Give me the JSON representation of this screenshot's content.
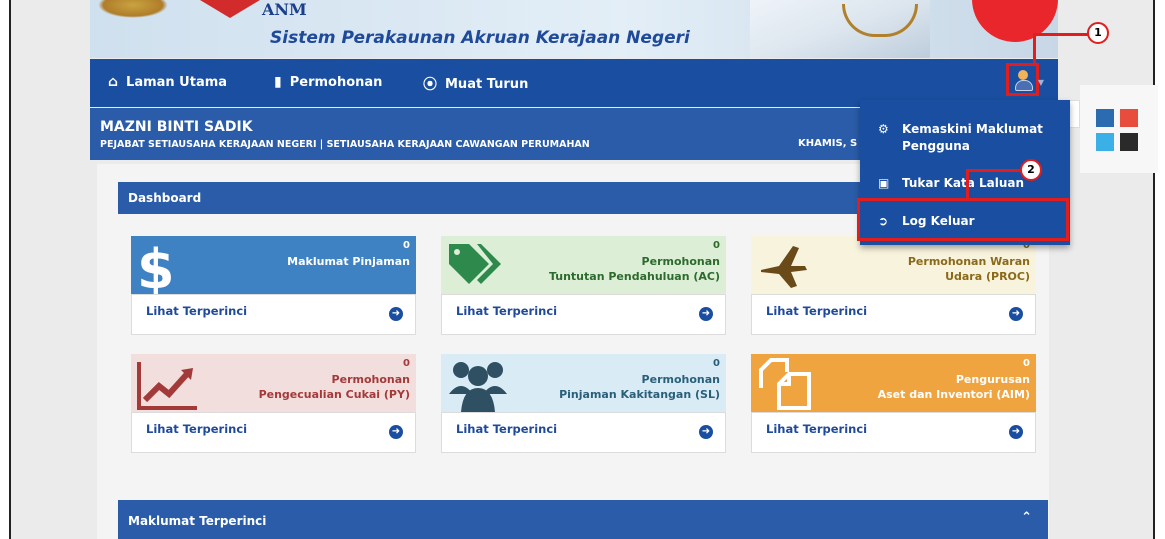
{
  "banner": {
    "org_short": "ANM",
    "system_title": "Sistem Perakaunan Akruan Kerajaan Negeri"
  },
  "nav": {
    "items": [
      {
        "label": "Laman Utama",
        "icon": "home-icon"
      },
      {
        "label": "Permohonan",
        "icon": "book-icon"
      },
      {
        "label": "Muat Turun",
        "icon": "download-icon"
      }
    ]
  },
  "user": {
    "name": "MAZNI BINTI SADIK",
    "department": "PEJABAT SETIAUSAHA KERAJAAN NEGERI | SETIAUSAHA KERAJAAN CAWANGAN PERUMAHAN",
    "date_partial": "KHAMIS, S"
  },
  "dashboard": {
    "title": "Dashboard",
    "cards": [
      {
        "count": "0",
        "title": "Maklumat Pinjaman",
        "link": "Lihat Terperinci",
        "icon": "dollar-icon",
        "color": "#3f82c4"
      },
      {
        "count": "0",
        "title_line1": "Permohonan",
        "title_line2": "Tuntutan Pendahuluan (AC)",
        "link": "Lihat Terperinci",
        "icon": "tags-icon",
        "color": "#dcefd6"
      },
      {
        "count": "0",
        "title_line1": "Permohonan Waran",
        "title_line2": "Udara (PROC)",
        "link": "Lihat Terperinci",
        "icon": "plane-icon",
        "color": "#f7f3dc"
      },
      {
        "count": "0",
        "title_line1": "Permohonan",
        "title_line2": "Pengecualian Cukai (PY)",
        "link": "Lihat Terperinci",
        "icon": "chart-line-icon",
        "color": "#f3dede"
      },
      {
        "count": "0",
        "title_line1": "Permohonan",
        "title_line2": "Pinjaman Kakitangan (SL)",
        "link": "Lihat Terperinci",
        "icon": "users-icon",
        "color": "#d9ecf5"
      },
      {
        "count": "0",
        "title_line1": "Pengurusan",
        "title_line2": "Aset dan Inventori (AIM)",
        "link": "Lihat Terperinci",
        "icon": "files-icon",
        "color": "#f0a440"
      }
    ]
  },
  "details": {
    "title": "Maklumat Terperinci"
  },
  "user_menu": {
    "items": [
      {
        "line1": "Kemaskini Maklumat",
        "line2": "Pengguna",
        "icon": "gear-icon"
      },
      {
        "label": "Tukar Kata Laluan",
        "icon": "lock-icon"
      },
      {
        "label": "Log Keluar",
        "icon": "sign-out-icon"
      }
    ]
  },
  "annotations": {
    "marker1": "1",
    "marker2": "2",
    "highlight_color": "#e11d1d"
  },
  "theme_swatches": [
    "#2b6cb0",
    "#e84c3d",
    "#3ab0e6",
    "#2a2a2a"
  ]
}
